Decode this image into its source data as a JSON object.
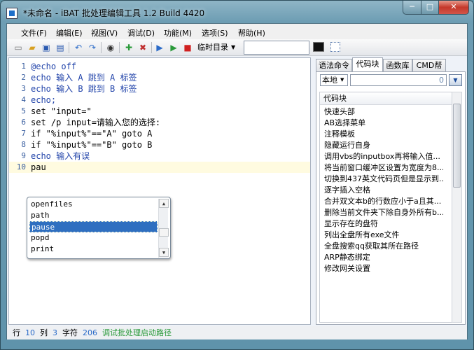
{
  "window": {
    "title": "*未命名 - iBAT 批处理编辑工具 1.2 Build 4420",
    "controls": {
      "minimize": "─",
      "maximize": "□",
      "close": "✕"
    }
  },
  "menu": [
    "文件(F)",
    "编辑(E)",
    "视图(V)",
    "调试(D)",
    "功能(M)",
    "选项(S)",
    "帮助(H)"
  ],
  "toolbar": {
    "directory": "临时目录",
    "path_value": ""
  },
  "editor": {
    "lines": [
      {
        "n": "1",
        "text": "@echo off"
      },
      {
        "n": "2",
        "text": "echo 输入 A 跳到 A 标签"
      },
      {
        "n": "3",
        "text": "echo 输入 B 跳到 B 标签"
      },
      {
        "n": "4",
        "text": "echo;"
      },
      {
        "n": "5",
        "text": "set \"input=\""
      },
      {
        "n": "6",
        "text": "set /p input=请输入您的选择:"
      },
      {
        "n": "7",
        "text": "if \"%input%\"==\"A\" goto A"
      },
      {
        "n": "8",
        "text": "if \"%input%\"==\"B\" goto B"
      },
      {
        "n": "9",
        "text": "echo 输入有误"
      },
      {
        "n": "10",
        "text": "pau"
      }
    ],
    "autocomplete": [
      "openfiles",
      "path",
      "pause",
      "popd",
      "print"
    ],
    "autocomplete_selected": 2
  },
  "right_panel": {
    "tabs": [
      "语法命令",
      "代码块",
      "函数库",
      "CMD帮助"
    ],
    "active_tab": 1,
    "scope": "本地",
    "count": "0",
    "list_header": "代码块",
    "items": [
      "快速头部",
      "AB选择菜单",
      "注释模板",
      "隐藏运行自身",
      "调用vbs的inputbox再将输入值...",
      "将当前窗口缓冲区设置为宽度为8...",
      "切换到437英文代码页但是显示到...",
      "逐字插入空格",
      "合并双文本b的行数应小于a且其...",
      "删除当前文件夹下除自身外所有b...",
      "显示存在的盘符",
      "列出全盘所有exe文件",
      "全盘搜索qq获取其所在路径",
      "ARP静态绑定",
      "修改网关设置"
    ]
  },
  "status": {
    "line_label": "行",
    "line": "10",
    "col_label": "列",
    "col": "3",
    "chars_label": "字符",
    "chars": "206",
    "debug_path": "调试批处理启动路径"
  }
}
